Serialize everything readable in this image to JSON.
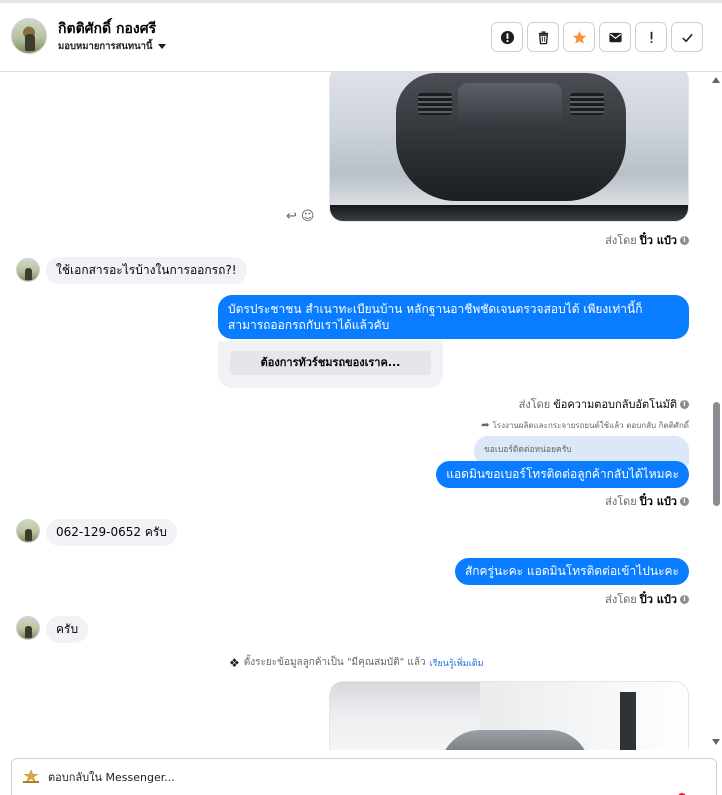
{
  "header": {
    "contact_name": "กิตติศักดิ์ กองศรี",
    "assign_label": "มอบหมายการสนทนานี้",
    "actions": [
      {
        "name": "report-spam-button",
        "icon": "exclamation-circle-icon"
      },
      {
        "name": "delete-button",
        "icon": "trash-icon"
      },
      {
        "name": "star-button",
        "icon": "star-icon",
        "color": "#f7923a"
      },
      {
        "name": "mark-unread-button",
        "icon": "envelope-icon"
      },
      {
        "name": "flag-button",
        "icon": "exclamation-icon"
      },
      {
        "name": "mark-done-button",
        "icon": "check-icon"
      }
    ]
  },
  "thread": {
    "sent_by_prefix": "ส่งโดย",
    "sender_name": "ปิ๋ว แป๋ว",
    "auto_sender": "ข้อความตอบกลับอัตโนมัติ",
    "messages": {
      "in_1": "ใช้เอกสารอะไรบ้างในการออกรถ?!",
      "out_1": "บัตรประชาชน สำเนาทะเบียนบ้าน หลักฐานอาชีพชัดเจนตรวจสอบได้ เพียงเท่านี้ก็สามารถออกรถกับเราได้แล้วคับ",
      "quick_reply_button": "ต้องการทัวร์ชมรถของเราค...",
      "reply_meta": "โรงงานผลิตและกระจายรถยนต์ใช้แล้ว ตอบกลับ กิตติศักดิ์",
      "quoted_text": "ขอเบอร์ติดต่อหน่อยครับ",
      "out_2": "แอดมินขอเบอร์โทรติดต่อลูกค้ากลับได้ไหมคะ",
      "in_2": "062-129-0652 ครับ",
      "out_3": "สักครู่นะคะ แอดมินโทรติดต่อเข้าไปนะคะ",
      "in_3": "ครับ"
    },
    "system_note": "ตั้งระยะข้อมูลลูกค้าเป็น \"มีคุณสมบัติ\" แล้ว",
    "system_link": "เรียนรู้เพิ่มเติม"
  },
  "composer": {
    "placeholder": "ตอบกลับใน Messenger..."
  },
  "colors": {
    "outgoing_bubble": "#0a7cff",
    "incoming_bubble": "#f0f2f5",
    "star": "#f7923a"
  }
}
